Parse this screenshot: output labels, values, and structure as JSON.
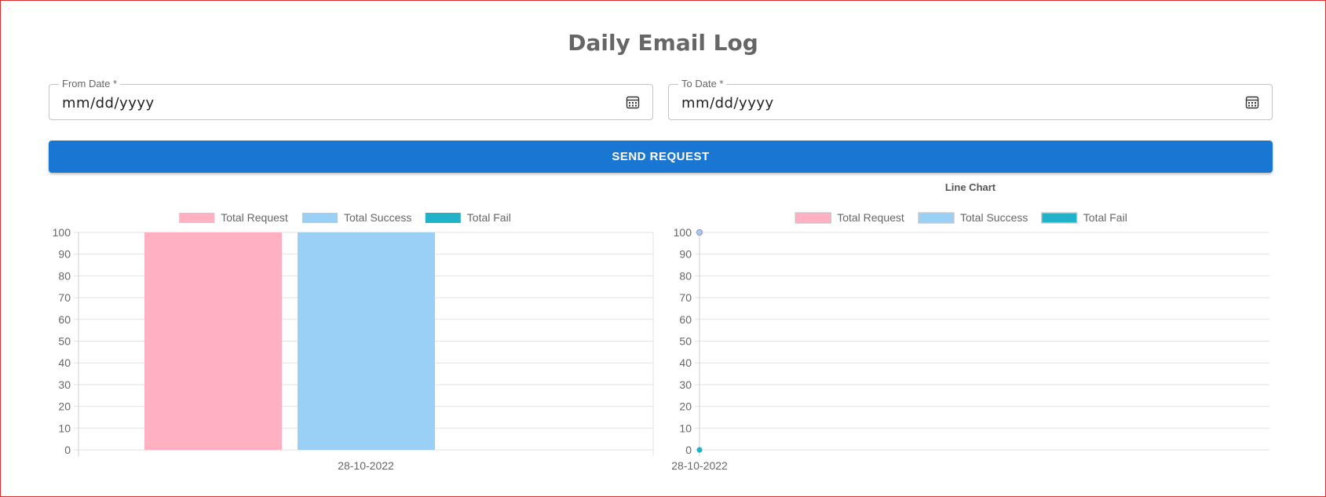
{
  "page": {
    "title": "Daily Email Log"
  },
  "filters": {
    "from_date": {
      "label": "From Date *",
      "value": "mm/dd/yyyy"
    },
    "to_date": {
      "label": "To Date *",
      "value": "mm/dd/yyyy"
    }
  },
  "actions": {
    "send_label": "SEND REQUEST"
  },
  "colors": {
    "primary": "#1976d2",
    "total_request": "#ffb1c1",
    "total_success": "#9ad0f5",
    "total_fail": "#20b2c8"
  },
  "chart_data": [
    {
      "type": "bar",
      "title": "",
      "categories": [
        "28-10-2022"
      ],
      "series": [
        {
          "name": "Total Request",
          "values": [
            100
          ]
        },
        {
          "name": "Total Success",
          "values": [
            100
          ]
        },
        {
          "name": "Total Fail",
          "values": [
            0
          ]
        }
      ],
      "ylim": [
        0,
        100
      ],
      "yticks": [
        "0",
        "10",
        "20",
        "30",
        "40",
        "50",
        "60",
        "70",
        "80",
        "90",
        "100"
      ],
      "legend": "top-center",
      "grid": true
    },
    {
      "type": "line",
      "title": "Line Chart",
      "categories": [
        "28-10-2022"
      ],
      "series": [
        {
          "name": "Total Request",
          "values": [
            100
          ]
        },
        {
          "name": "Total Success",
          "values": [
            100
          ]
        },
        {
          "name": "Total Fail",
          "values": [
            0
          ]
        }
      ],
      "ylim": [
        0,
        100
      ],
      "yticks": [
        "0",
        "10",
        "20",
        "30",
        "40",
        "50",
        "60",
        "70",
        "80",
        "90",
        "100"
      ],
      "legend": "top-center",
      "grid": true
    }
  ]
}
